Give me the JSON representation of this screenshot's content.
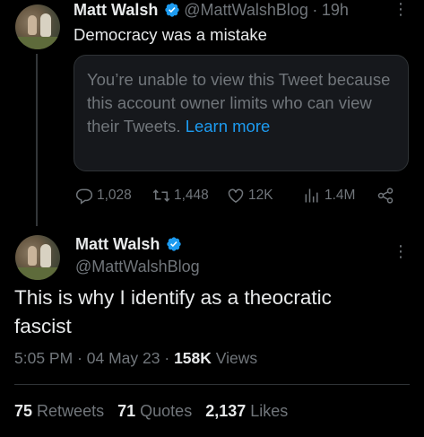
{
  "reply_tweet": {
    "author_name": "Matt Walsh",
    "author_handle": "@MattWalshBlog",
    "separator": "·",
    "time_ago": "19h",
    "text": "Democracy was a mistake",
    "hidden_card": {
      "message": "You’re unable to view this Tweet because this account owner limits who can view their Tweets.",
      "link_text": "Learn more"
    },
    "actions": {
      "replies": "1,028",
      "retweets": "1,448",
      "likes": "12K",
      "views": "1.4M"
    }
  },
  "main_tweet": {
    "author_name": "Matt Walsh",
    "author_handle": "@MattWalshBlog",
    "text": "This is why I identify as a theocratic fascist",
    "time": "5:05 PM",
    "separator": "·",
    "date": "04 May 23",
    "views_count": "158K",
    "views_label": "Views",
    "stats": {
      "retweets_count": "75",
      "retweets_label": "Retweets",
      "quotes_count": "71",
      "quotes_label": "Quotes",
      "likes_count": "2,137",
      "likes_label": "Likes"
    }
  },
  "colors": {
    "background": "#000000",
    "text": "#e7e9ea",
    "muted": "#71767b",
    "accent": "#1d9bf0"
  }
}
